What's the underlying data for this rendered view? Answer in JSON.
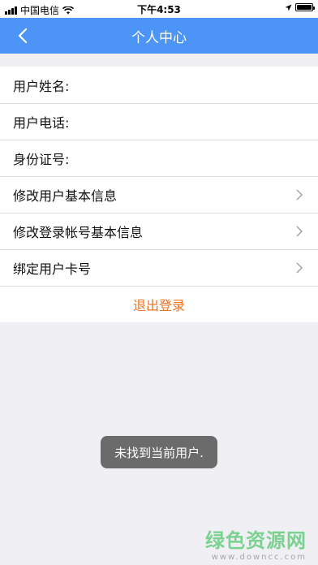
{
  "status_bar": {
    "carrier": "中国电信",
    "time": "下午4:53"
  },
  "header": {
    "title": "个人中心"
  },
  "list": {
    "items": [
      {
        "label": "用户姓名:"
      },
      {
        "label": "用户电话:"
      },
      {
        "label": "身份证号:"
      },
      {
        "label": "修改用户基本信息"
      },
      {
        "label": "修改登录帐号基本信息"
      },
      {
        "label": "绑定用户卡号"
      }
    ],
    "logout_label": "退出登录"
  },
  "toast": {
    "message": "未找到当前用户."
  },
  "watermark": {
    "title": "绿色资源网",
    "url": "www.downcc.com"
  },
  "colors": {
    "header_bg": "#4c94f5",
    "logout_text": "#f07020",
    "page_bg": "#efeff4",
    "toast_bg": "#6b6b6b"
  }
}
